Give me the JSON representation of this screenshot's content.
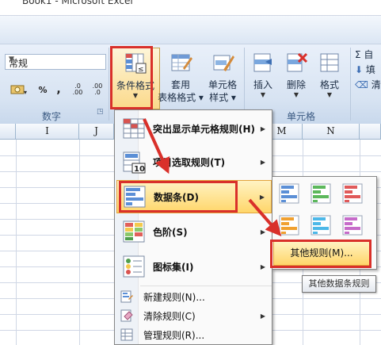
{
  "window": {
    "title": "Book1 - Microsoft Excel"
  },
  "ribbon": {
    "number_group": {
      "format_value": "常规",
      "currency_label": "",
      "percent_label": "%",
      "comma_label": ",",
      "increase_decimal_label": ".0 .00",
      "decrease_decimal_label": ".00 .0",
      "group_label": "数字"
    },
    "styles_group": {
      "conditional_formatting_label": "条件格式",
      "table_format_label_1": "套用",
      "table_format_label_2": "表格格式",
      "cell_styles_label_1": "单元格",
      "cell_styles_label_2": "样式"
    },
    "cells_group": {
      "insert_label": "插入",
      "delete_label": "删除",
      "format_label": "格式",
      "group_label": "单元格"
    },
    "editing_group": {
      "items": [
        "Σ 自",
        "填",
        "清"
      ]
    }
  },
  "sheet": {
    "columns": [
      "I",
      "J",
      "M",
      "N"
    ]
  },
  "menu": {
    "items": [
      {
        "label": "突出显示单元格规则(H)",
        "has_submenu": true
      },
      {
        "label": "项目选取规则(T)",
        "has_submenu": true
      },
      {
        "label": "数据条(D)",
        "has_submenu": true,
        "active": true
      },
      {
        "label": "色阶(S)",
        "has_submenu": true
      },
      {
        "label": "图标集(I)",
        "has_submenu": true
      },
      {
        "label": "新建规则(N)...",
        "has_submenu": false
      },
      {
        "label": "清除规则(C)",
        "has_submenu": true
      },
      {
        "label": "管理规则(R)...",
        "has_submenu": false
      }
    ]
  },
  "submenu": {
    "more_rules_label": "其他规则(M)...",
    "tooltip": "其他数据条规则",
    "data_bar_colors": [
      "#5b8fd6",
      "#5cb85c",
      "#e05a5a",
      "#f0a030",
      "#4db8e8",
      "#c66bc9"
    ]
  },
  "colors": {
    "highlight_red": "#d9302a",
    "menu_active": "#ffd66a"
  }
}
